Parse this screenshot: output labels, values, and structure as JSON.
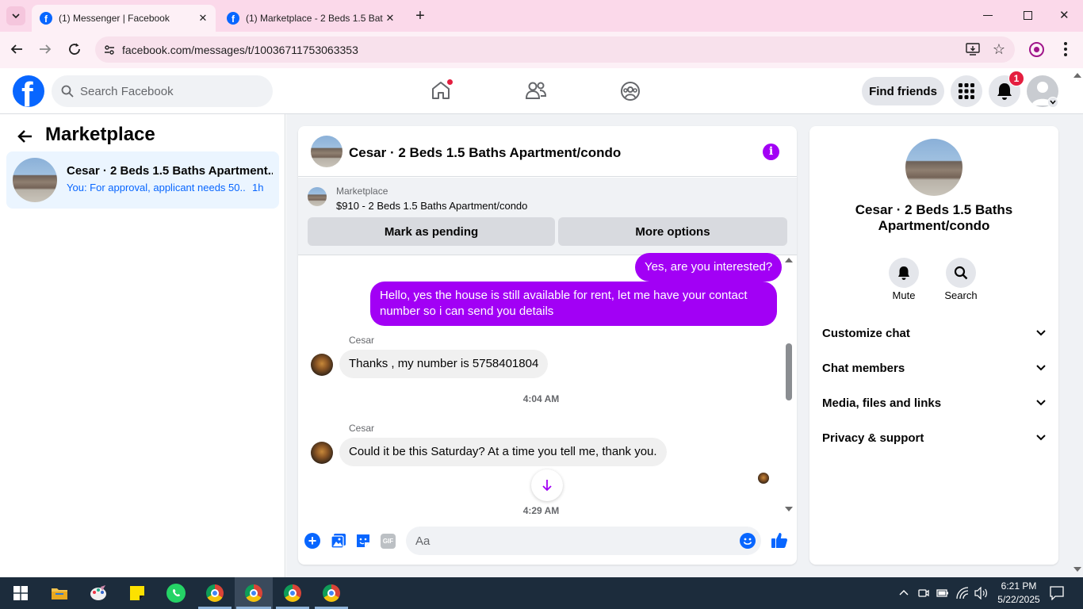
{
  "browser": {
    "tabs": [
      {
        "title": "(1) Messenger | Facebook",
        "active": true
      },
      {
        "title": "(1) Marketplace - 2 Beds 1.5 Bat",
        "active": false
      }
    ],
    "url": "facebook.com/messages/t/10036711753063353"
  },
  "header": {
    "search_placeholder": "Search Facebook",
    "find_friends": "Find friends",
    "notification_count": "1"
  },
  "sidebar": {
    "title": "Marketplace",
    "conversations": [
      {
        "name": "Cesar · 2 Beds 1.5 Baths Apartment...",
        "preview": "You: For approval, applicant needs 50...",
        "time": "1h"
      }
    ]
  },
  "chat": {
    "title": "Cesar · 2 Beds 1.5 Baths Apartment/condo",
    "listing": {
      "label": "Marketplace",
      "summary": "$910 - 2 Beds 1.5 Baths Apartment/condo",
      "mark_pending": "Mark as pending",
      "more_options": "More options"
    },
    "messages": {
      "m1": "Yes, are you interested?",
      "m2": "Hello, yes the house is still available for rent, let me have your contact number so i can send you  details",
      "sender1": "Cesar",
      "m3": "Thanks , my number is 5758401804",
      "time1": "4:04 AM",
      "sender2": "Cesar",
      "m4": "Could it be this Saturday? At a time you tell me, thank you.",
      "time2": "4:29 AM"
    },
    "composer_placeholder": "Aa"
  },
  "info_panel": {
    "name": "Cesar · 2 Beds 1.5 Baths Apartment/condo",
    "mute": "Mute",
    "search": "Search",
    "sections": [
      "Customize chat",
      "Chat members",
      "Media, files and links",
      "Privacy & support"
    ]
  },
  "taskbar": {
    "time": "6:21 PM",
    "date": "5/22/2025"
  },
  "colors": {
    "fb_blue": "#0866ff",
    "my_bubble": "#a200f5",
    "notif_red": "#e41e3f"
  }
}
